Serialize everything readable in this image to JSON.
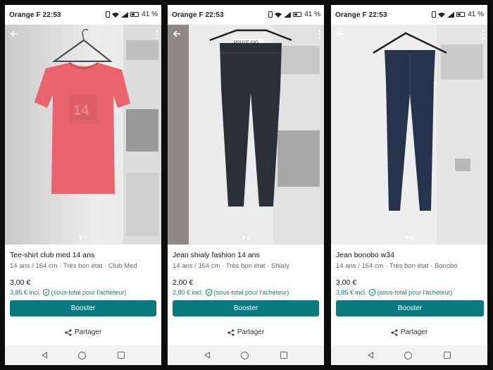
{
  "status": {
    "carrier": "Orange F",
    "time": "22:53",
    "battery": "41 %"
  },
  "listings": [
    {
      "title": "Tee-shirt club med 14 ans",
      "meta": "14 ans / 164 cm · Très bon état · Club Med",
      "price": "3,00 €",
      "price_incl": "3,85 € incl.",
      "buyer_note": "(sous-total pour l'acheteur)",
      "boost_label": "Booster",
      "share_label": "Partager",
      "garment_color": "#e8636b"
    },
    {
      "title": "Jean shialy fashion 14 ans",
      "meta": "14 ans / 164 cm · Très bon état · Shialy",
      "price": "2,00 €",
      "price_incl": "2,80 € incl.",
      "buyer_note": "(sous-total pour l'acheteur)",
      "boost_label": "Booster",
      "share_label": "Partager",
      "garment_color": "#2b2f3a"
    },
    {
      "title": "Jean bonobo w34",
      "meta": "14 ans / 164 cm · Très bon état · Bonobo",
      "price": "3,00 €",
      "price_incl": "3,85 € incl.",
      "buyer_note": "(sous-total pour l'acheteur)",
      "boost_label": "Booster",
      "share_label": "Partager",
      "garment_color": "#25344c"
    }
  ],
  "colors": {
    "accent": "#0b7a80",
    "link": "#0f7f86"
  },
  "icons": [
    "back-arrow-icon",
    "more-vert-icon",
    "shield-icon",
    "share-icon",
    "vibrate-icon",
    "wifi-icon",
    "signal-icon",
    "battery-icon"
  ]
}
